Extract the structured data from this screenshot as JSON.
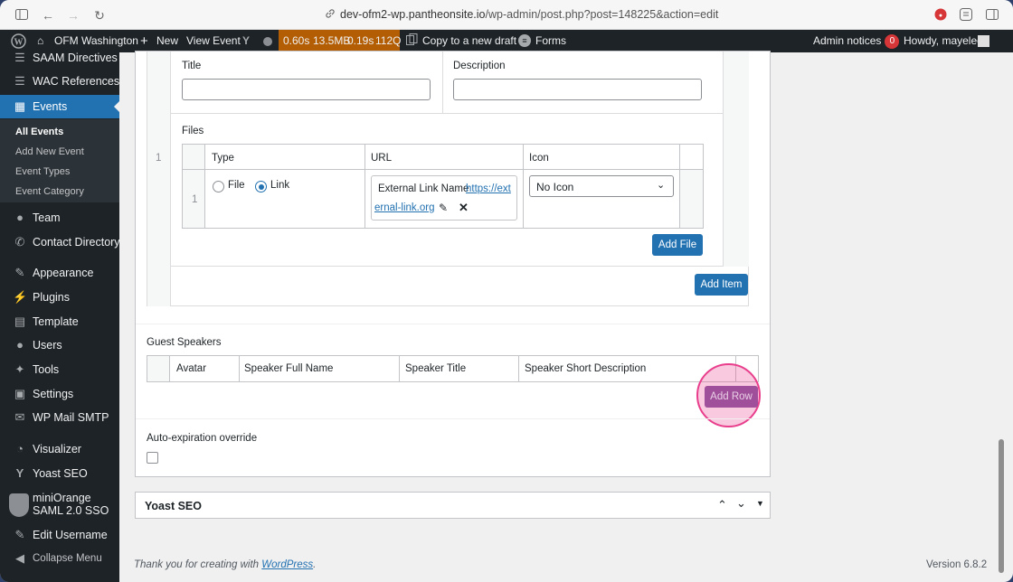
{
  "browser": {
    "url_host": "dev-ofm2-wp.pantheonsite.io",
    "url_path": "/wp-admin/post.php?post=148225&action=edit"
  },
  "adminbar": {
    "site_name": "OFM Washington",
    "new_label": "New",
    "view_label": "View Event",
    "perf": [
      "0.60s",
      "13.5MB",
      "0.19s",
      "112Q"
    ],
    "copy_draft": "Copy to a new draft",
    "forms": "Forms",
    "admin_notices": "Admin notices",
    "notices_count": "0",
    "howdy": "Howdy, mayelee"
  },
  "sidebar": {
    "items": [
      {
        "label": "SAAM Directives",
        "icon": "database-icon"
      },
      {
        "label": "WAC References",
        "icon": "database-icon"
      },
      {
        "label": "Events",
        "icon": "calendar-icon"
      },
      {
        "label": "Team",
        "icon": "groups-icon"
      },
      {
        "label": "Contact Directory",
        "icon": "phone-icon"
      },
      {
        "label": "Appearance",
        "icon": "brush-icon"
      },
      {
        "label": "Plugins",
        "icon": "plugin-icon"
      },
      {
        "label": "Template",
        "icon": "table-icon"
      },
      {
        "label": "Users",
        "icon": "user-icon"
      },
      {
        "label": "Tools",
        "icon": "wrench-icon"
      },
      {
        "label": "Settings",
        "icon": "settings-icon"
      },
      {
        "label": "WP Mail SMTP",
        "icon": "mail-icon"
      },
      {
        "label": "Visualizer",
        "icon": "chart-icon"
      },
      {
        "label": "Yoast SEO",
        "icon": "yoast-icon"
      },
      {
        "label": "miniOrange",
        "label2": "SAML 2.0 SSO",
        "icon": "shield-icon"
      },
      {
        "label": "Edit Username",
        "icon": "pencil-icon"
      },
      {
        "label": "Collapse Menu",
        "icon": "collapse-icon"
      }
    ],
    "submenu": [
      "All Events",
      "Add New Event",
      "Event Types",
      "Event Category"
    ]
  },
  "repeater": {
    "title_label": "Title",
    "description_label": "Description",
    "files_label": "Files",
    "row_number": "1",
    "files_headers": [
      "Type",
      "URL",
      "Icon"
    ],
    "file_row_number": "1",
    "type_options": [
      "File",
      "Link"
    ],
    "type_selected": "Link",
    "link_name": "External Link Name",
    "link_url_1": "https://ext",
    "link_url_2": "ernal-link.org",
    "icon_value": "No Icon",
    "add_file": "Add File",
    "add_item": "Add Item"
  },
  "guest_speakers": {
    "label": "Guest Speakers",
    "headers": [
      "Avatar",
      "Speaker Full Name",
      "Speaker Title",
      "Speaker Short Description"
    ],
    "add_row": "Add Row"
  },
  "auto_expiration": {
    "label": "Auto-expiration override"
  },
  "yoast_box": {
    "title": "Yoast SEO"
  },
  "footer": {
    "thanks_prefix": "Thank you for creating with ",
    "thanks_link": "WordPress",
    "thanks_suffix": ".",
    "version": "Version 6.8.2"
  },
  "colors": {
    "accent": "#2271b1",
    "admin_bar": "#1d2327",
    "perf_bar": "#b35e04",
    "highlight": "#e83e8c"
  }
}
